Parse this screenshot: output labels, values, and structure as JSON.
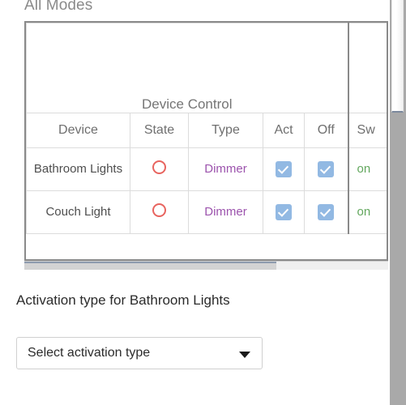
{
  "section": {
    "heading": "All Modes"
  },
  "table": {
    "group_header": "Device Control",
    "columns": [
      "Device",
      "State",
      "Type",
      "Act",
      "Off",
      "Sw"
    ],
    "rows": [
      {
        "device": "Bathroom Lights",
        "state_icon": "circle-outline-icon",
        "type": "Dimmer",
        "act_checked": true,
        "off_checked": true,
        "sw": "on"
      },
      {
        "device": "Couch Light",
        "state_icon": "circle-outline-icon",
        "type": "Dimmer",
        "act_checked": true,
        "off_checked": true,
        "sw": "on"
      }
    ]
  },
  "form": {
    "label": "Activation type for Bathroom Lights",
    "select_value": "Select activation type",
    "caret_icon": "chevron-down-icon"
  },
  "colors": {
    "type_text": "#9c53ad",
    "sw_text": "#62a75d",
    "state_circle": "#e8645f",
    "checkbox": "#92b9e3",
    "heading_text": "#8a8a8a"
  }
}
